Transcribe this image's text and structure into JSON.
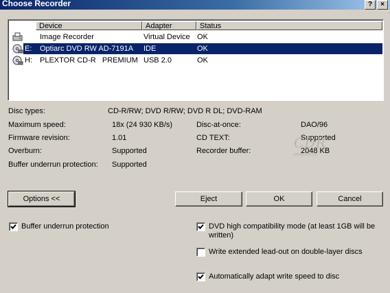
{
  "window": {
    "title": "Choose Recorder",
    "help_glyph": "?",
    "close_glyph": "×"
  },
  "list": {
    "columns": [
      "Device",
      "Adapter",
      "Status"
    ],
    "rows": [
      {
        "letter": "",
        "device": "Image Recorder",
        "adapter": "Virtual Device",
        "status": "OK",
        "icon": "image-recorder-icon"
      },
      {
        "letter": "E:",
        "device": "Optiarc DVD RW AD-7191A",
        "adapter": "IDE",
        "status": "OK",
        "icon": "optical-drive-icon"
      },
      {
        "letter": "H:",
        "device": "PLEXTOR CD-R   PREMIUM",
        "adapter": "USB 2.0",
        "status": "OK",
        "icon": "optical-drive-icon"
      }
    ],
    "selected_index": 1
  },
  "info": {
    "disc_types_label": "Disc types:",
    "disc_types_value": "CD-R/RW; DVD R/RW; DVD R DL; DVD-RAM",
    "max_speed_label": "Maximum speed:",
    "max_speed_value": "18x (24 930 KB/s)",
    "firmware_label": "Firmware revision:",
    "firmware_value": "1.01",
    "overburn_label": "Overburn:",
    "overburn_value": "Supported",
    "bup_label": "Buffer underrun protection:",
    "bup_value": "Supported",
    "dao_label": "Disc-at-once:",
    "dao_value": "DAO/96",
    "cdtext_label": "CD TEXT:",
    "cdtext_value": "Supported",
    "buffer_label": "Recorder buffer:",
    "buffer_value": "2048 KB"
  },
  "watermark": {
    "text": "CDR",
    "url": "www.cdr.cz"
  },
  "buttons": {
    "options": "Options <<",
    "eject": "Eject",
    "ok": "OK",
    "cancel": "Cancel"
  },
  "options": [
    {
      "label": "Buffer underrun protection",
      "checked": true
    },
    {
      "label": "DVD high compatibility mode (at least 1GB will be",
      "label2": "written)",
      "checked": true
    },
    {
      "label": "Write extended lead-out on double-layer discs",
      "checked": false
    },
    {
      "label": "Automatically adapt write speed to disc",
      "checked": true
    }
  ]
}
